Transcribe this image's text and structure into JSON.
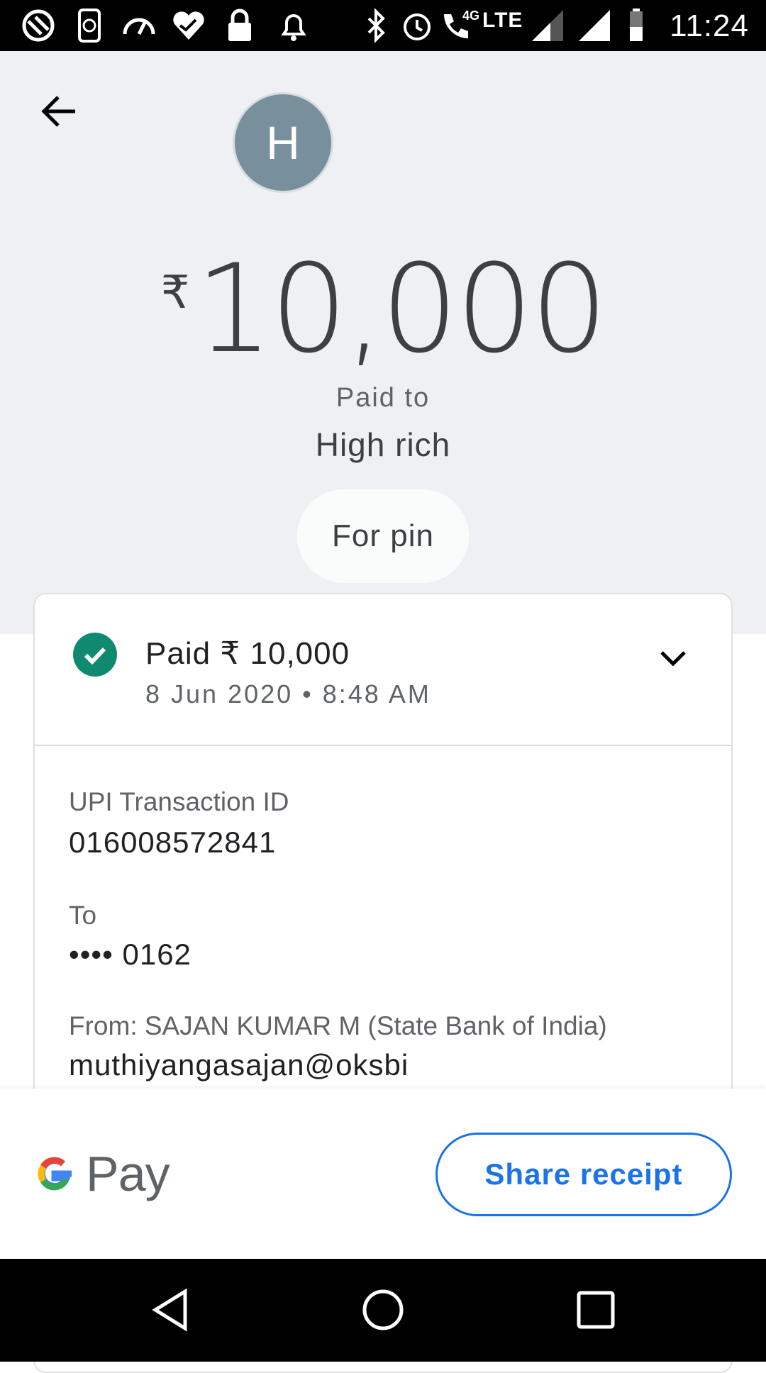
{
  "status_bar": {
    "time": "11:24",
    "network_type": "LTE",
    "call_badge": "4G",
    "icons": [
      "app-icon",
      "sync-phone-icon",
      "speedometer-icon",
      "health-heart-icon",
      "lock-icon",
      "bell-icon",
      "bluetooth-icon",
      "alarm-icon",
      "wifi-call-icon",
      "signal-icon",
      "signal-icon",
      "battery-icon"
    ]
  },
  "payee": {
    "avatar_letter": "H",
    "avatar_color": "#78909c",
    "currency_symbol": "₹",
    "amount": "10,000",
    "paid_to_label": "Paid to",
    "name": "High rich",
    "note": "For pin"
  },
  "transaction": {
    "status_title": "Paid ₹ 10,000",
    "date_time": "8 Jun 2020 • 8:48 AM",
    "status_color": "#0f8a6f",
    "details": [
      {
        "label": "UPI Transaction ID",
        "value": "016008572841"
      },
      {
        "label": "To",
        "value": "•••• 0162"
      },
      {
        "label": "From: SAJAN KUMAR  M (State Bank of India)",
        "value": "muthiyangasajan@oksbi"
      }
    ]
  },
  "footer": {
    "brand": "Pay",
    "share_label": "Share receipt",
    "accent_color": "#1a73e8"
  },
  "nav_icons": [
    "back-triangle-icon",
    "home-circle-icon",
    "recents-square-icon"
  ]
}
